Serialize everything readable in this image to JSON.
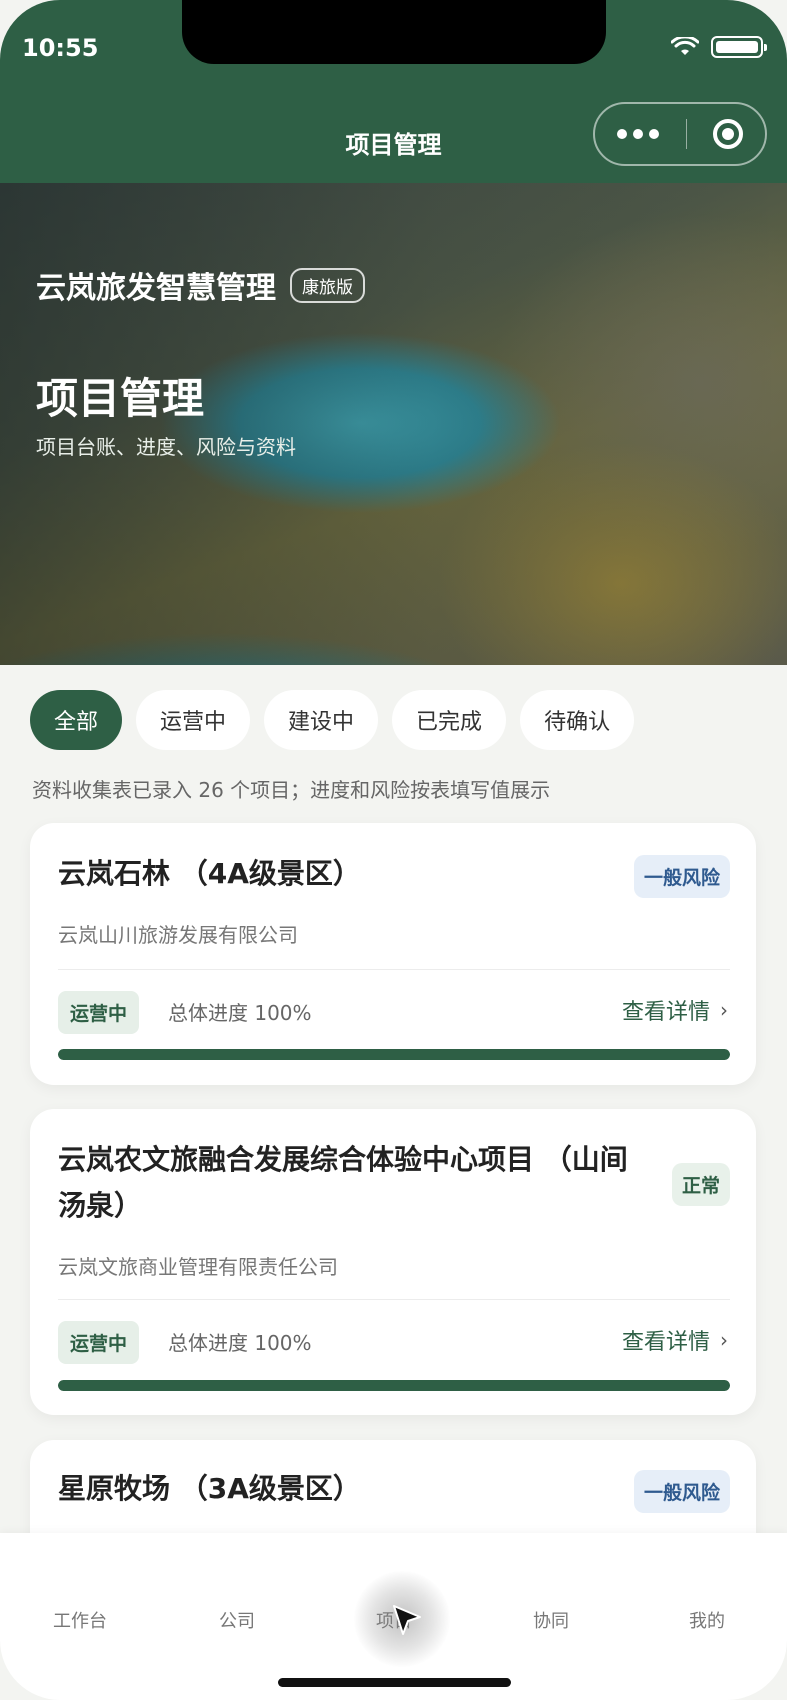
{
  "status_bar": {
    "time": "10:55"
  },
  "nav": {
    "title": "项目管理"
  },
  "hero": {
    "brand": "云岚旅发智慧管理",
    "edition_badge": "康旅版",
    "title": "项目管理",
    "subtitle": "项目台账、进度、风险与资料"
  },
  "filters": [
    {
      "label": "全部",
      "active": true
    },
    {
      "label": "运营中",
      "active": false
    },
    {
      "label": "建设中",
      "active": false
    },
    {
      "label": "已完成",
      "active": false
    },
    {
      "label": "待确认",
      "active": false
    }
  ],
  "summary": "资料收集表已录入 26 个项目；进度和风险按表填写值展示",
  "projects": [
    {
      "title": "云岚石林 （4A级景区）",
      "risk": "一般风险",
      "company": "云岚山川旅游发展有限公司",
      "status": "运营中",
      "progress_text": "总体进度 100%",
      "progress": 1.0,
      "detail_label": "查看详情"
    },
    {
      "title": "云岚农文旅融合发展综合体验中心项目 （山间汤泉）",
      "risk": "正常",
      "company": "云岚文旅商业管理有限责任公司",
      "status": "运营中",
      "progress_text": "总体进度 100%",
      "progress": 1.0,
      "detail_label": "查看详情"
    },
    {
      "title": "星原牧场 （3A级景区）",
      "risk": "一般风险"
    }
  ],
  "tabbar": {
    "items": [
      "工作台",
      "公司",
      "项目",
      "协同",
      "我的"
    ]
  },
  "colors": {
    "primary": "#2e5f45",
    "risk_general_bg": "#e6eef8",
    "risk_general_text": "#2f5a8f"
  }
}
